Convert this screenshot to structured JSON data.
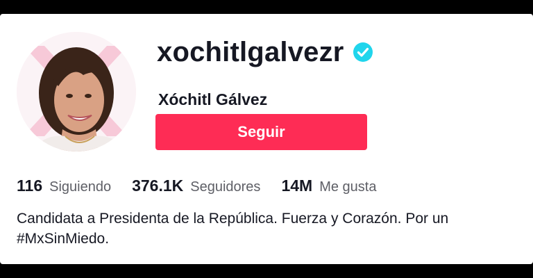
{
  "profile": {
    "username": "xochitlgalvezr",
    "display_name": "Xóchitl Gálvez",
    "verified_icon": "verified-badge-icon",
    "follow_label": "Seguir"
  },
  "stats": {
    "following_count": "116",
    "following_label": "Siguiendo",
    "followers_count": "376.1K",
    "followers_label": "Seguidores",
    "likes_count": "14M",
    "likes_label": "Me gusta"
  },
  "bio": {
    "line1": "Candidata a Presidenta de la República. Fuerza y Corazón. Por un",
    "line2": "#MxSinMiedo."
  },
  "colors": {
    "accent": "#fe2c55",
    "verified": "#20d5ec",
    "text": "#161823",
    "muted": "#5e5f66"
  }
}
